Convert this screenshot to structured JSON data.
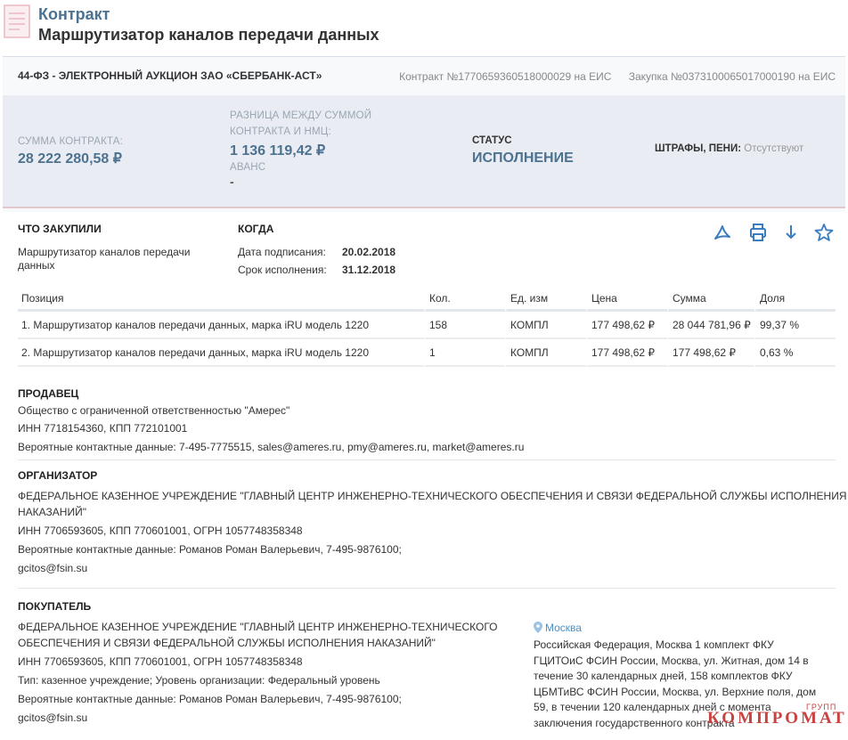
{
  "header": {
    "label": "Контракт",
    "title": "Маршрутизатор каналов передачи данных"
  },
  "card": {
    "procurement_type": "44-ФЗ - ЭЛЕКТРОННЫЙ АУКЦИОН ЗАО «СБЕРБАНК-АСТ»",
    "contract_no": "Контракт №1770659360518000029 на ЕИС",
    "purchase_no": "Закупка №0373100065017000190 на ЕИС"
  },
  "summary": {
    "sum_label": "СУММА КОНТРАКТА:",
    "sum_value": "28 222 280,58 ₽",
    "diff_label_1": "РАЗНИЦА МЕЖДУ СУММОЙ",
    "diff_label_2": "КОНТРАКТА И НМЦ:",
    "diff_value": "1 136 119,42 ₽",
    "advance_label": "АВАНС",
    "advance_value": "-",
    "status_label": "СТАТУС",
    "status_value": "ИСПОЛНЕНИЕ",
    "fines_label": "ШТРАФЫ, ПЕНИ:",
    "fines_value": "Отсутствуют"
  },
  "what": {
    "heading": "ЧТО ЗАКУПИЛИ",
    "text_1": "Маршрутизатор каналов передачи",
    "text_2": "данных"
  },
  "when": {
    "heading": "КОГДА",
    "signed_label": "Дата подписания:",
    "signed_value": "20.02.2018",
    "due_label": "Срок исполнения:",
    "due_value": "31.12.2018"
  },
  "table": {
    "headers": [
      "Позиция",
      "Кол.",
      "Ед. изм",
      "Цена",
      "Сумма",
      "Доля"
    ],
    "rows": [
      [
        "1. Маршрутизатор каналов передачи данных, марка iRU модель 1220",
        "158",
        "КОМПЛ",
        "177 498,62 ₽",
        "28 044 781,96 ₽",
        "99,37 %"
      ],
      [
        "2. Маршрутизатор каналов передачи данных, марка iRU модель 1220",
        "1",
        "КОМПЛ",
        "177 498,62 ₽",
        "177 498,62 ₽",
        "0,63 %"
      ]
    ]
  },
  "seller": {
    "heading": "ПРОДАВЕЦ",
    "name": "Общество с ограниченной ответственностью \"Амерес\"",
    "ids": "ИНН 7718154360, КПП 772101001",
    "contacts": "Вероятные контактные данные: 7-495-7775515, sales@ameres.ru, pmy@ameres.ru, market@ameres.ru"
  },
  "organizer": {
    "heading": "ОРГАНИЗАТОР",
    "name_1": "ФЕДЕРАЛЬНОЕ КАЗЕННОЕ УЧРЕЖДЕНИЕ \"ГЛАВНЫЙ ЦЕНТР ИНЖЕНЕРНО-ТЕХНИЧЕСКОГО ОБЕСПЕЧЕНИЯ И СВЯЗИ ФЕДЕРАЛЬНОЙ СЛУЖБЫ ИСПОЛНЕНИЯ",
    "name_2": "НАКАЗАНИЙ\"",
    "ids": "ИНН 7706593605, КПП 770601001, ОГРН 1057748358348",
    "contacts": "Вероятные контактные данные: Романов Роман Валерьевич, 7-495-9876100;",
    "email": "gcitos@fsin.su"
  },
  "buyer": {
    "heading": "ПОКУПАТЕЛЬ",
    "name_1": "ФЕДЕРАЛЬНОЕ КАЗЕННОЕ УЧРЕЖДЕНИЕ \"ГЛАВНЫЙ ЦЕНТР ИНЖЕНЕРНО-ТЕХНИЧЕСКОГО",
    "name_2": "ОБЕСПЕЧЕНИЯ И СВЯЗИ ФЕДЕРАЛЬНОЙ СЛУЖБЫ ИСПОЛНЕНИЯ НАКАЗАНИЙ\"",
    "ids": "ИНН 7706593605, КПП 770601001, ОГРН 1057748358348",
    "type": "Тип: казенное учреждение; Уровень организации: Федеральный уровень",
    "contacts": "Вероятные контактные данные: Романов Роман Валерьевич, 7-495-9876100;",
    "email": "gcitos@fsin.su",
    "city": "Москва",
    "address_1": "Российская Федерация, Москва 1 комплект ФКУ",
    "address_2": "ГЦИТОиС ФСИН России, Москва, ул. Житная, дом 14 в",
    "address_3": "течение 30 календарных дней, 158 комплектов ФКУ",
    "address_4": "ЦБМТиВС ФСИН России, Москва, ул. Верхние поля, дом",
    "address_5": "59, в течении 120 календарных дней с момента",
    "address_6": "заключения государственного контракта"
  },
  "watermark": {
    "text": "КОМПРОМАТ",
    "small": "ГРУПП"
  },
  "colors": {
    "accent": "#4d7290",
    "action_blue": "#3a7cc0",
    "summary_bg": "#e9edf3",
    "watermark": "#c9423f"
  },
  "icons": [
    "document-icon",
    "pdf-icon",
    "print-icon",
    "download-icon",
    "star-icon",
    "location-pin-icon"
  ]
}
